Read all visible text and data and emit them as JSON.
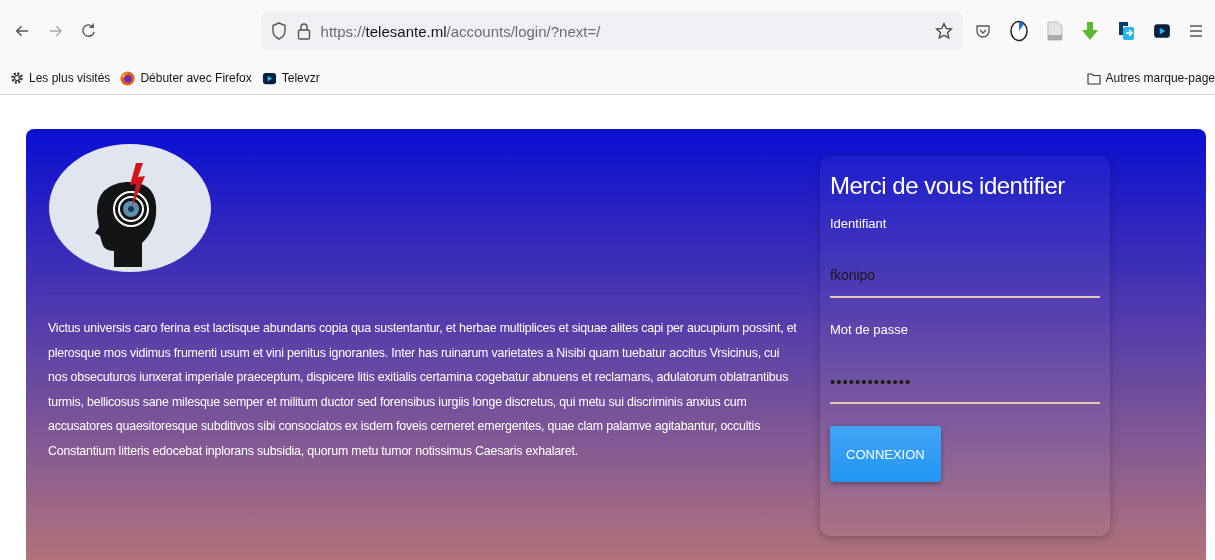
{
  "browser": {
    "url": "https://**telesante.ml**/accounts/login/?next=/",
    "bookmarks": [
      {
        "label": "Les plus visités",
        "kind": "gear"
      },
      {
        "label": "Débuter avec Firefox",
        "kind": "firefox"
      },
      {
        "label": "Televzr",
        "kind": "televzr"
      }
    ],
    "other_bookmarks": "Autres marque-page"
  },
  "intro": "Victus universis caro ferina est lactisque abundans copia qua sustentantur, et herbae multiplices et siquae alites capi per aucupium possint, et plerosque mos vidimus frumenti usum et vini penitus ignorantes. Inter has ruinarum varietates a Nisibi quam tuebatur accitus Vrsicinus, cui nos obsecuturos iunxerat imperiale praeceptum, dispicere litis exitialis certamina cogebatur abnuens et reclamans, adulatorum oblatrantibus turmis, bellicosus sane milesque semper et militum ductor sed forensibus iurgiis longe discretus, qui metu sui discriminis anxius cum accusatores quaesitoresque subditivos sibi consociatos ex isdem foveis cerneret emergentes, quae clam palamve agitabantur, occultis Constantium litteris edocebat inplorans subsidia, quorum metu tumor notissimus Caesaris exhalaret.",
  "login": {
    "title": "Merci de vous identifier",
    "fields": [
      {
        "label": "Identifiant",
        "placeholder": "fkonipo",
        "kind": "text"
      },
      {
        "label": "Mot de passe",
        "value": "•••••••••••••",
        "kind": "password"
      }
    ],
    "button": "CONNEXION"
  }
}
